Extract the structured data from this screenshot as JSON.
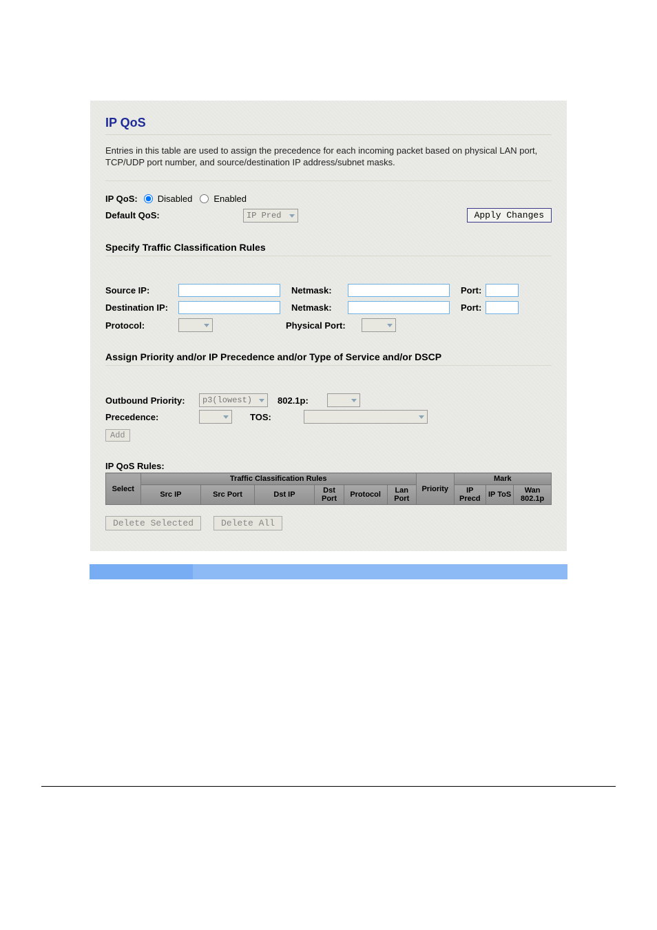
{
  "header": {
    "title": "IP QoS"
  },
  "desc": "Entries in this table are used to assign the precedence for each incoming packet based on physical LAN port, TCP/UDP port number, and source/destination IP address/subnet masks.",
  "qos": {
    "label": "IP QoS:",
    "disabled_label": "Disabled",
    "enabled_label": "Enabled",
    "selected": "disabled",
    "default_label": "Default QoS:",
    "default_value": "IP Pred",
    "apply_label": "Apply Changes"
  },
  "classify": {
    "title": "Specify Traffic Classification Rules",
    "source_ip_label": "Source IP:",
    "source_ip": "",
    "dest_ip_label": "Destination IP:",
    "dest_ip": "",
    "netmask_label": "Netmask:",
    "netmask1": "",
    "netmask2": "",
    "port_label": "Port:",
    "port1": "",
    "port2": "",
    "protocol_label": "Protocol:",
    "protocol": "",
    "physical_port_label": "Physical Port:",
    "physical_port": ""
  },
  "assign": {
    "title": "Assign Priority and/or IP Precedence and/or Type of Service and/or DSCP",
    "outbound_label": "Outbound Priority:",
    "outbound_value": "p3(lowest)",
    "p8021_label": "802.1p:",
    "p8021_value": "",
    "precedence_label": "Precedence:",
    "precedence_value": "",
    "tos_label": "TOS:",
    "tos_value": "",
    "add_label": "Add"
  },
  "rules": {
    "title": "IP QoS Rules:",
    "group1": "Traffic Classification Rules",
    "group2": "Mark",
    "cols": {
      "select": "Select",
      "srcip": "Src IP",
      "srcport": "Src Port",
      "dstip": "Dst IP",
      "dstport": "Dst Port",
      "protocol": "Protocol",
      "lanport": "Lan Port",
      "priority": "Priority",
      "ipprecd": "IP Precd",
      "iptos": "IP ToS",
      "wan8021p": "Wan 802.1p"
    },
    "delete_selected": "Delete Selected",
    "delete_all": "Delete All"
  }
}
